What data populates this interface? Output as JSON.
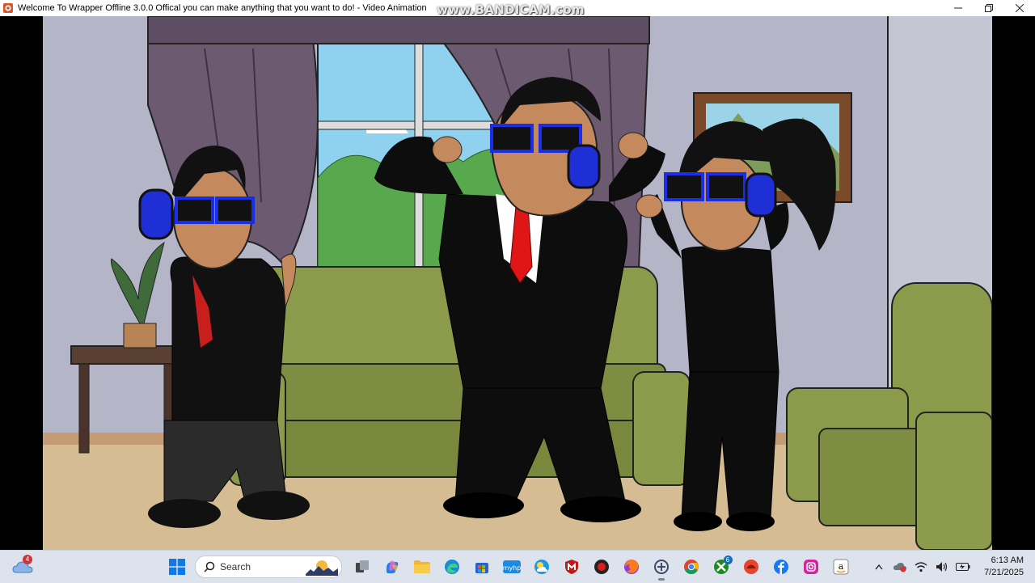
{
  "window": {
    "title": "Welcome To Wrapper Offline 3.0.0 Offical you can make anything that you want to do! - Video Animation",
    "watermark": "www.BANDICAM.com",
    "controls": [
      "minimize",
      "maximize",
      "close"
    ]
  },
  "scene": {
    "description_icons": [
      "curtain",
      "window",
      "sofa",
      "armchair",
      "side-table",
      "framed-picture",
      "plant"
    ]
  },
  "taskbar": {
    "weather_badge": "4",
    "search_label": "Search",
    "pinned": [
      {
        "name": "start-icon"
      },
      {
        "name": "task-view-icon"
      },
      {
        "name": "copilot-icon"
      },
      {
        "name": "file-explorer-icon"
      },
      {
        "name": "edge-icon"
      },
      {
        "name": "store-icon"
      },
      {
        "name": "mcafee-mywp-icon"
      },
      {
        "name": "weather-app-icon"
      },
      {
        "name": "mcafee-icon"
      },
      {
        "name": "record-icon"
      },
      {
        "name": "firefox-icon"
      },
      {
        "name": "wrapper-app-icon"
      },
      {
        "name": "chrome-icon"
      },
      {
        "name": "xbox-icon"
      },
      {
        "name": "game-app-icon"
      },
      {
        "name": "facebook-icon"
      },
      {
        "name": "instagram-icon"
      },
      {
        "name": "amazon-icon"
      }
    ],
    "xbox_badge": "6",
    "clock_time": "6:13 AM",
    "clock_date": "7/21/2025",
    "colors": {
      "accent": "#0f6cbd",
      "badge_red": "#d13438"
    }
  }
}
